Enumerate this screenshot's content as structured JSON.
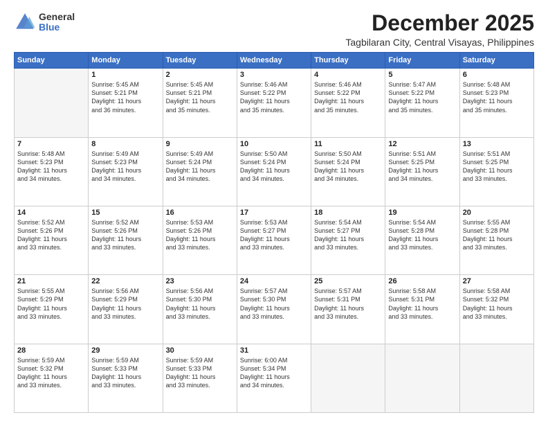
{
  "logo": {
    "general": "General",
    "blue": "Blue"
  },
  "title": {
    "month": "December 2025",
    "location": "Tagbilaran City, Central Visayas, Philippines"
  },
  "headers": [
    "Sunday",
    "Monday",
    "Tuesday",
    "Wednesday",
    "Thursday",
    "Friday",
    "Saturday"
  ],
  "weeks": [
    [
      {
        "day": "",
        "sunrise": "",
        "sunset": "",
        "daylight": ""
      },
      {
        "day": "1",
        "sunrise": "Sunrise: 5:45 AM",
        "sunset": "Sunset: 5:21 PM",
        "daylight": "Daylight: 11 hours and 36 minutes."
      },
      {
        "day": "2",
        "sunrise": "Sunrise: 5:45 AM",
        "sunset": "Sunset: 5:21 PM",
        "daylight": "Daylight: 11 hours and 35 minutes."
      },
      {
        "day": "3",
        "sunrise": "Sunrise: 5:46 AM",
        "sunset": "Sunset: 5:22 PM",
        "daylight": "Daylight: 11 hours and 35 minutes."
      },
      {
        "day": "4",
        "sunrise": "Sunrise: 5:46 AM",
        "sunset": "Sunset: 5:22 PM",
        "daylight": "Daylight: 11 hours and 35 minutes."
      },
      {
        "day": "5",
        "sunrise": "Sunrise: 5:47 AM",
        "sunset": "Sunset: 5:22 PM",
        "daylight": "Daylight: 11 hours and 35 minutes."
      },
      {
        "day": "6",
        "sunrise": "Sunrise: 5:48 AM",
        "sunset": "Sunset: 5:23 PM",
        "daylight": "Daylight: 11 hours and 35 minutes."
      }
    ],
    [
      {
        "day": "7",
        "sunrise": "Sunrise: 5:48 AM",
        "sunset": "Sunset: 5:23 PM",
        "daylight": "Daylight: 11 hours and 34 minutes."
      },
      {
        "day": "8",
        "sunrise": "Sunrise: 5:49 AM",
        "sunset": "Sunset: 5:23 PM",
        "daylight": "Daylight: 11 hours and 34 minutes."
      },
      {
        "day": "9",
        "sunrise": "Sunrise: 5:49 AM",
        "sunset": "Sunset: 5:24 PM",
        "daylight": "Daylight: 11 hours and 34 minutes."
      },
      {
        "day": "10",
        "sunrise": "Sunrise: 5:50 AM",
        "sunset": "Sunset: 5:24 PM",
        "daylight": "Daylight: 11 hours and 34 minutes."
      },
      {
        "day": "11",
        "sunrise": "Sunrise: 5:50 AM",
        "sunset": "Sunset: 5:24 PM",
        "daylight": "Daylight: 11 hours and 34 minutes."
      },
      {
        "day": "12",
        "sunrise": "Sunrise: 5:51 AM",
        "sunset": "Sunset: 5:25 PM",
        "daylight": "Daylight: 11 hours and 34 minutes."
      },
      {
        "day": "13",
        "sunrise": "Sunrise: 5:51 AM",
        "sunset": "Sunset: 5:25 PM",
        "daylight": "Daylight: 11 hours and 33 minutes."
      }
    ],
    [
      {
        "day": "14",
        "sunrise": "Sunrise: 5:52 AM",
        "sunset": "Sunset: 5:26 PM",
        "daylight": "Daylight: 11 hours and 33 minutes."
      },
      {
        "day": "15",
        "sunrise": "Sunrise: 5:52 AM",
        "sunset": "Sunset: 5:26 PM",
        "daylight": "Daylight: 11 hours and 33 minutes."
      },
      {
        "day": "16",
        "sunrise": "Sunrise: 5:53 AM",
        "sunset": "Sunset: 5:26 PM",
        "daylight": "Daylight: 11 hours and 33 minutes."
      },
      {
        "day": "17",
        "sunrise": "Sunrise: 5:53 AM",
        "sunset": "Sunset: 5:27 PM",
        "daylight": "Daylight: 11 hours and 33 minutes."
      },
      {
        "day": "18",
        "sunrise": "Sunrise: 5:54 AM",
        "sunset": "Sunset: 5:27 PM",
        "daylight": "Daylight: 11 hours and 33 minutes."
      },
      {
        "day": "19",
        "sunrise": "Sunrise: 5:54 AM",
        "sunset": "Sunset: 5:28 PM",
        "daylight": "Daylight: 11 hours and 33 minutes."
      },
      {
        "day": "20",
        "sunrise": "Sunrise: 5:55 AM",
        "sunset": "Sunset: 5:28 PM",
        "daylight": "Daylight: 11 hours and 33 minutes."
      }
    ],
    [
      {
        "day": "21",
        "sunrise": "Sunrise: 5:55 AM",
        "sunset": "Sunset: 5:29 PM",
        "daylight": "Daylight: 11 hours and 33 minutes."
      },
      {
        "day": "22",
        "sunrise": "Sunrise: 5:56 AM",
        "sunset": "Sunset: 5:29 PM",
        "daylight": "Daylight: 11 hours and 33 minutes."
      },
      {
        "day": "23",
        "sunrise": "Sunrise: 5:56 AM",
        "sunset": "Sunset: 5:30 PM",
        "daylight": "Daylight: 11 hours and 33 minutes."
      },
      {
        "day": "24",
        "sunrise": "Sunrise: 5:57 AM",
        "sunset": "Sunset: 5:30 PM",
        "daylight": "Daylight: 11 hours and 33 minutes."
      },
      {
        "day": "25",
        "sunrise": "Sunrise: 5:57 AM",
        "sunset": "Sunset: 5:31 PM",
        "daylight": "Daylight: 11 hours and 33 minutes."
      },
      {
        "day": "26",
        "sunrise": "Sunrise: 5:58 AM",
        "sunset": "Sunset: 5:31 PM",
        "daylight": "Daylight: 11 hours and 33 minutes."
      },
      {
        "day": "27",
        "sunrise": "Sunrise: 5:58 AM",
        "sunset": "Sunset: 5:32 PM",
        "daylight": "Daylight: 11 hours and 33 minutes."
      }
    ],
    [
      {
        "day": "28",
        "sunrise": "Sunrise: 5:59 AM",
        "sunset": "Sunset: 5:32 PM",
        "daylight": "Daylight: 11 hours and 33 minutes."
      },
      {
        "day": "29",
        "sunrise": "Sunrise: 5:59 AM",
        "sunset": "Sunset: 5:33 PM",
        "daylight": "Daylight: 11 hours and 33 minutes."
      },
      {
        "day": "30",
        "sunrise": "Sunrise: 5:59 AM",
        "sunset": "Sunset: 5:33 PM",
        "daylight": "Daylight: 11 hours and 33 minutes."
      },
      {
        "day": "31",
        "sunrise": "Sunrise: 6:00 AM",
        "sunset": "Sunset: 5:34 PM",
        "daylight": "Daylight: 11 hours and 34 minutes."
      },
      {
        "day": "",
        "sunrise": "",
        "sunset": "",
        "daylight": ""
      },
      {
        "day": "",
        "sunrise": "",
        "sunset": "",
        "daylight": ""
      },
      {
        "day": "",
        "sunrise": "",
        "sunset": "",
        "daylight": ""
      }
    ]
  ]
}
